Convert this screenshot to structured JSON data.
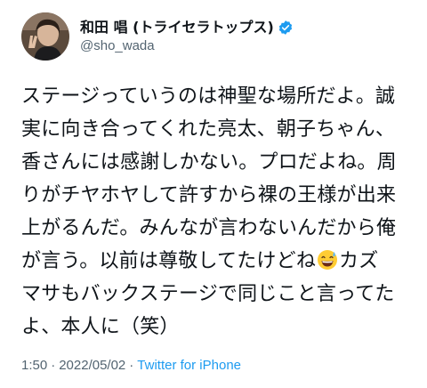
{
  "user": {
    "display_name": "和田 唱 (トライセラトップス)",
    "handle": "@sho_wada",
    "verified": true
  },
  "tweet": {
    "lines": [
      "ステージっていうのは神聖な場所だよ。誠",
      "実に向き合ってくれた亮太、朝子ちゃん、",
      "香さんには感謝しかない。プロだよね。周",
      "りがチヤホヤして許すから裸の王様が出来",
      "上がるんだ。みんなが言わないんだから俺",
      "が言う。以前は尊敬してたけどね",
      "カズ",
      "マサもバックステージで同じこと言ってた",
      "よ、本人に（笑）"
    ],
    "emoji": "grinning-face-with-sweat"
  },
  "meta": {
    "time": "1:50",
    "separator": "·",
    "date": "2022/05/02",
    "source": "Twitter for iPhone"
  },
  "colors": {
    "text": "#0f1419",
    "secondary": "#536471",
    "link": "#1d9bf0",
    "verified": "#1d9bf0"
  }
}
